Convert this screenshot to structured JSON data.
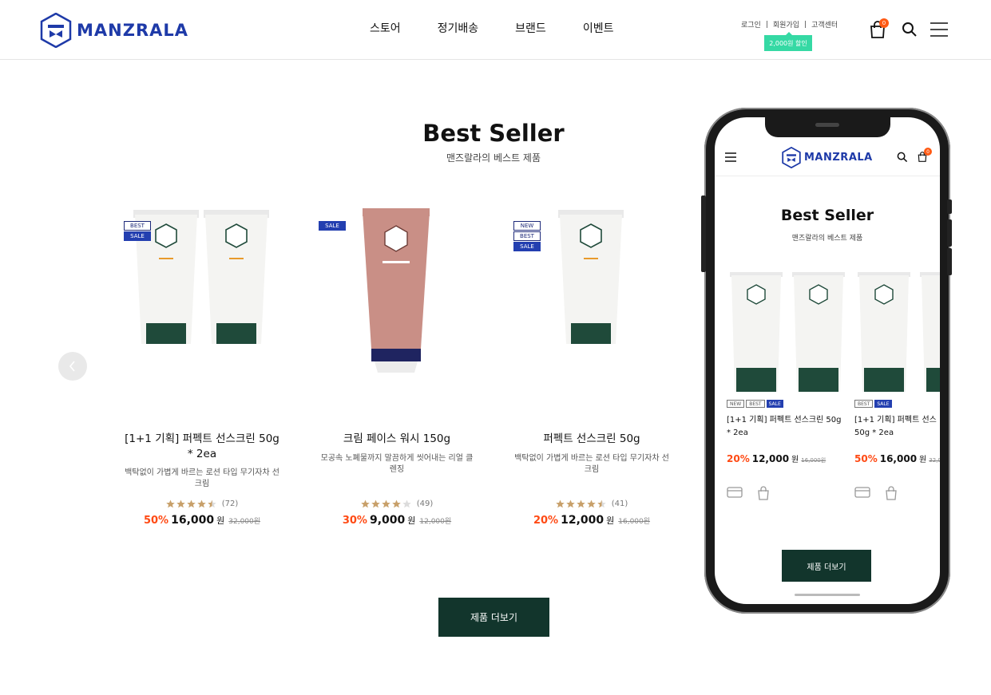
{
  "brand": {
    "name": "MANZRALA",
    "color": "#1e3aa8"
  },
  "nav": {
    "items": [
      "스토어",
      "정기배송",
      "브랜드",
      "이벤트"
    ]
  },
  "util": {
    "login": "로그인",
    "signup": "회원가입",
    "support": "고객센터",
    "coupon": "2,000원 할인",
    "cart_count": "0"
  },
  "section": {
    "title": "Best Seller",
    "subtitle": "맨즈랄라의 베스트 제품",
    "more_label": "제품 더보기"
  },
  "products": [
    {
      "name": "[1+1 기획] 퍼펙트 선스크린 50g * 2ea",
      "desc": "백탁없이 가볍게 바르는 로션 타입 무기자차 선크림",
      "badges": [
        "BEST",
        "SALE"
      ],
      "rating": 4.5,
      "reviews": "(72)",
      "discount": "50%",
      "price": "16,000",
      "won": "원",
      "original": "32,000원"
    },
    {
      "name": "크림 페이스 워시 150g",
      "desc": "모공속 노폐물까지 말끔하게 씻어내는 리얼 클렌징",
      "badges": [
        "SALE"
      ],
      "rating": 4,
      "reviews": "(49)",
      "discount": "30%",
      "price": "9,000",
      "won": "원",
      "original": "12,000원"
    },
    {
      "name": "퍼펙트 선스크린 50g",
      "desc": "백탁없이 가볍게 바르는 로션 타입 무기자차 선크림",
      "badges": [
        "NEW",
        "BEST",
        "SALE"
      ],
      "rating": 4.5,
      "reviews": "(41)",
      "discount": "20%",
      "price": "12,000",
      "won": "원",
      "original": "16,000원"
    }
  ],
  "mobile": {
    "brand": "MANZRALA",
    "cart_count": "0",
    "title": "Best Seller",
    "subtitle": "맨즈랄라의 베스트 제품",
    "cards": [
      {
        "badges": [
          "NEW",
          "BEST",
          "SALE"
        ],
        "name": "[1+1 기획] 퍼펙트 선스크린 50g * 2ea",
        "discount": "20%",
        "price": "12,000",
        "won": "원",
        "original": "16,000원"
      },
      {
        "badges": [
          "BEST",
          "SALE"
        ],
        "name": "[1+1 기획] 퍼펙트 선스",
        "name2": "50g * 2ea",
        "discount": "50%",
        "price": "16,000",
        "won": "원",
        "original": "32,000"
      }
    ],
    "more_label": "제품 더보기"
  },
  "colors": {
    "accent": "#12352c",
    "badge": "#233fb0",
    "discount": "#ff4a14",
    "coupon": "#35d9a4"
  }
}
